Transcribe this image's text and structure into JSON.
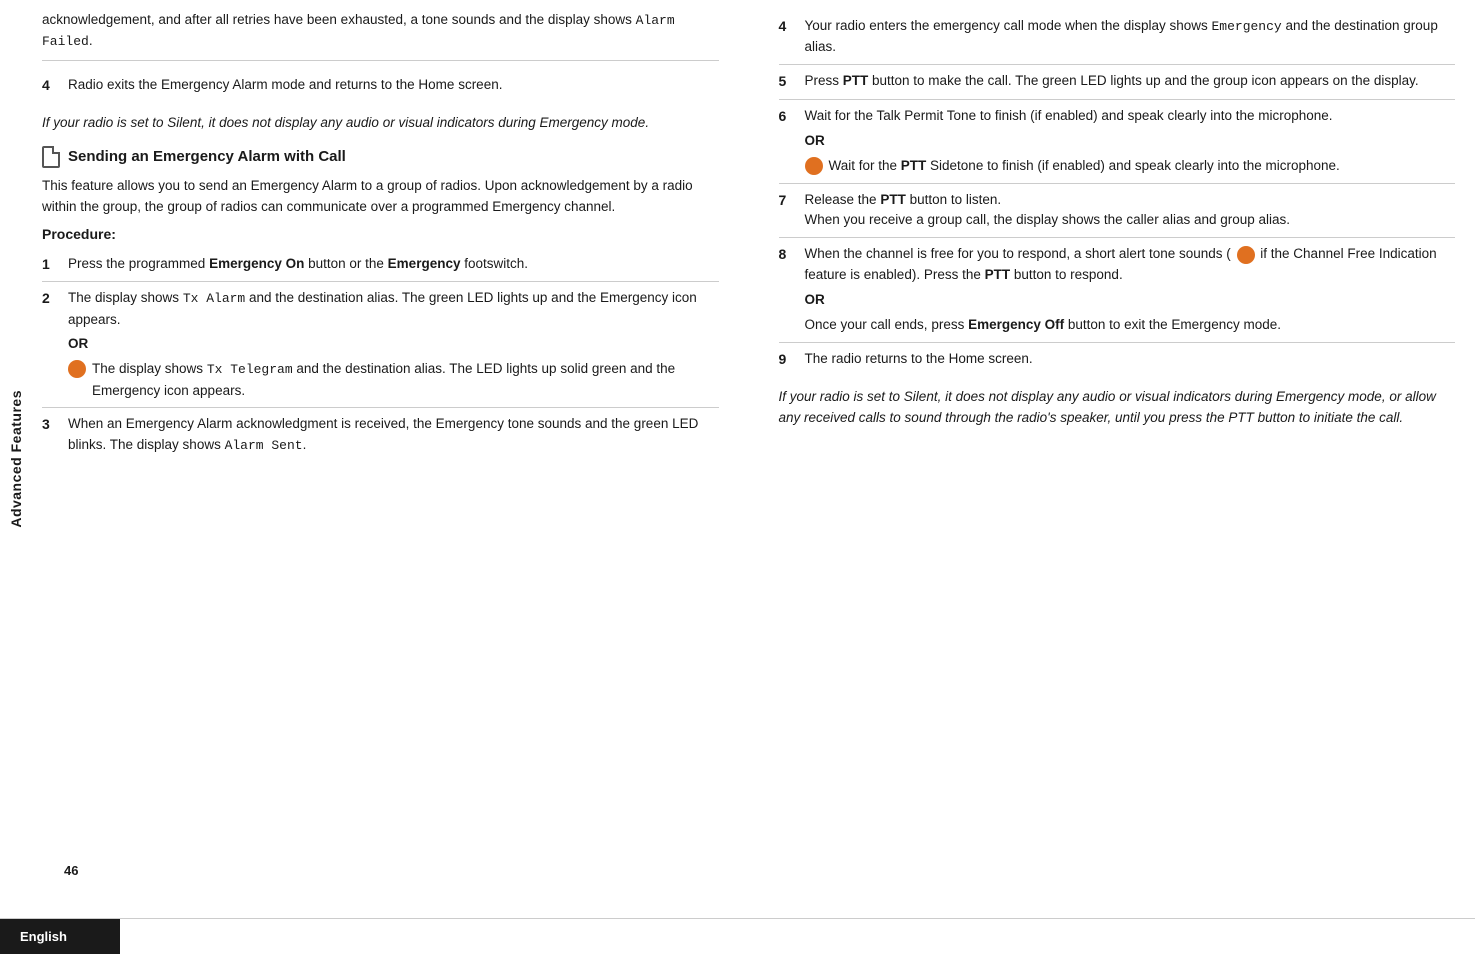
{
  "sidebar": {
    "label": "Advanced Features"
  },
  "footer": {
    "language": "English",
    "page_number": "46"
  },
  "left_column": {
    "intro": {
      "text": "acknowledgement, and after all retries have been exhausted, a tone sounds and the display shows ",
      "mono1": "Alarm",
      "mono2": "Failed",
      "period": "."
    },
    "step4": {
      "num": "4",
      "text": "Radio exits the Emergency Alarm mode and returns to the Home screen."
    },
    "italic_note": "If your radio is set to Silent, it does not display any audio or visual indicators during Emergency mode.",
    "section_heading": "Sending an Emergency Alarm with Call",
    "feature_desc": "This feature allows you to send an Emergency Alarm to a group of radios. Upon acknowledgement by a radio within the group, the group of radios can communicate over a programmed Emergency channel.",
    "procedure_label": "Procedure:",
    "steps": [
      {
        "num": "1",
        "text_before": "Press the programmed ",
        "bold1": "Emergency On",
        "text_mid": " button or the ",
        "bold2": "Emergency",
        "text_after": " footswitch."
      },
      {
        "num": "2",
        "text_before": "The display shows ",
        "mono": "Tx Alarm",
        "text_mid": " and the destination alias. The green LED lights up and the Emergency icon appears.",
        "or": "OR",
        "sub_text_before": "The display shows ",
        "sub_mono": "Tx Telegram",
        "sub_text_after": " and the destination alias. The LED lights up solid green and the Emergency icon appears."
      },
      {
        "num": "3",
        "text_before": "When an Emergency Alarm acknowledgment is received, the Emergency tone sounds and the green LED blinks. The display shows ",
        "mono": "Alarm Sent",
        "text_after": "."
      }
    ]
  },
  "right_column": {
    "steps": [
      {
        "num": "4",
        "text_before": "Your radio enters the emergency call mode when the display shows ",
        "mono": "Emergency",
        "text_after": " and the destination group alias."
      },
      {
        "num": "5",
        "text_before": "Press ",
        "bold1": "PTT",
        "text_after": " button to make the call. The green LED lights up and the group icon appears on the display."
      },
      {
        "num": "6",
        "text_main": "Wait for the Talk Permit Tone to finish (if enabled) and speak clearly into the microphone.",
        "or": "OR",
        "sub_text_before": "Wait for the ",
        "sub_bold": "PTT",
        "sub_text_after": " Sidetone to finish (if enabled) and speak clearly into the microphone."
      },
      {
        "num": "7",
        "text_before": "Release the ",
        "bold1": "PTT",
        "text_mid": " button to listen.",
        "text_after": "When you receive a group call, the display shows the caller alias and group alias."
      },
      {
        "num": "8",
        "text_main": "When the channel is free for you to respond, a short alert tone sounds (",
        "icon_note": "if the Channel Free Indication feature is enabled). Press the ",
        "bold1": "PTT",
        "text_mid": " button to respond.",
        "or": "OR",
        "sub_text_before": "Once your call ends, press ",
        "sub_bold": "Emergency Off",
        "sub_text_after": " button to exit the Emergency mode."
      },
      {
        "num": "9",
        "text": "The radio returns to the Home screen."
      }
    ],
    "italic_note": "If your radio is set to Silent, it does not display any audio or visual indicators during Emergency mode, or allow any received calls to sound through the radio's speaker, until you press the PTT button to initiate the call."
  }
}
